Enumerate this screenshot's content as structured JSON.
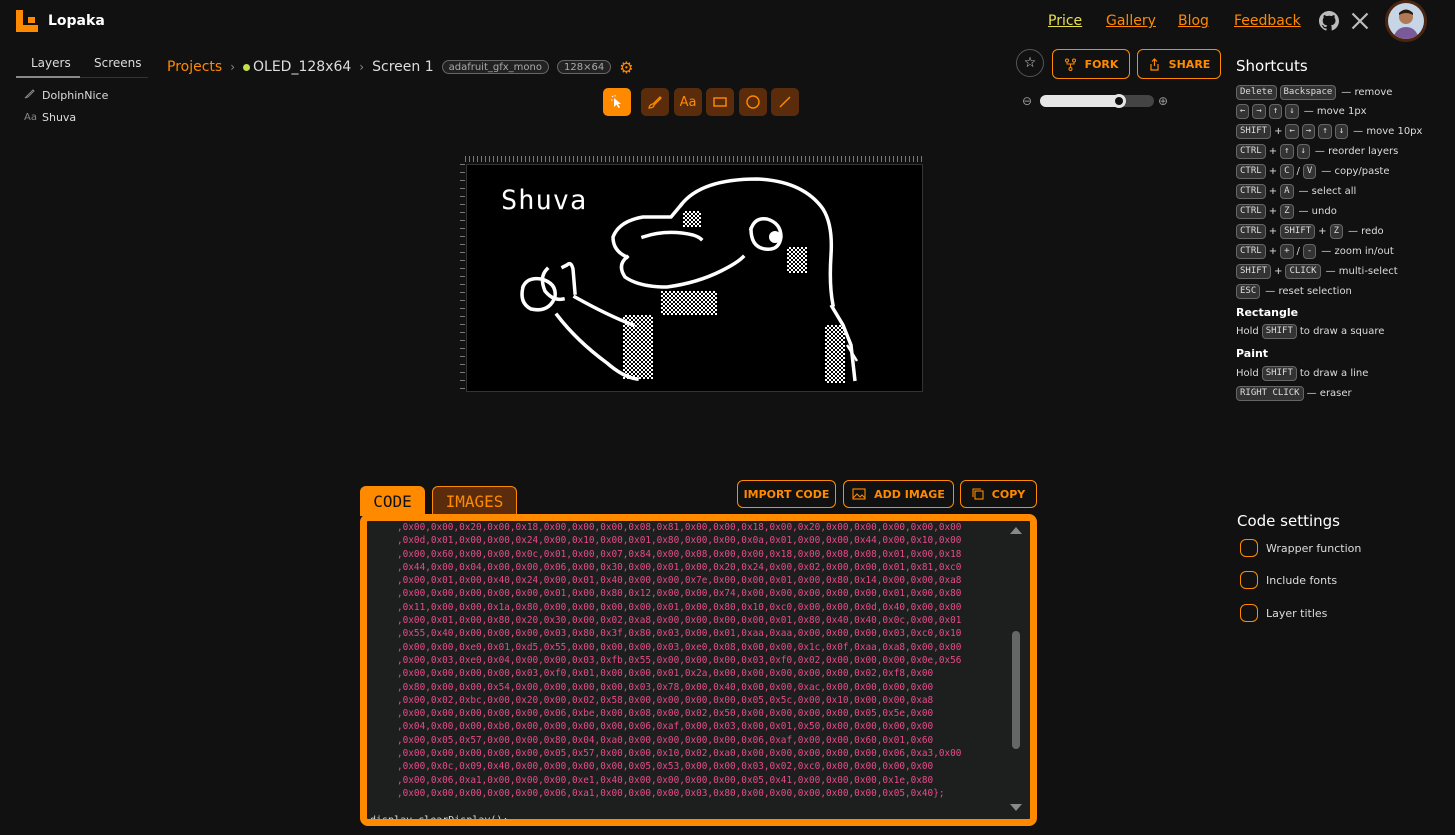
{
  "app": {
    "name": "Lopaka",
    "accent": "#ff8a00"
  },
  "nav": {
    "price": "Price",
    "gallery": "Gallery",
    "blog": "Blog",
    "feedback": "Feedback"
  },
  "left_panel": {
    "tabs": [
      "Layers",
      "Screens"
    ],
    "layers": [
      {
        "name": "DolphinNice",
        "icon": "paint-icon"
      },
      {
        "name": "Shuva",
        "icon": "text-icon",
        "icon_glyph": "Aa"
      }
    ]
  },
  "breadcrumb": {
    "projects": "Projects",
    "project": "OLED_128x64",
    "screen": "Screen 1",
    "library": "adafruit_gfx_mono",
    "size": "128×64"
  },
  "toolbar": {
    "text_tool": "Aa"
  },
  "actions": {
    "fork": "FORK",
    "share": "SHARE",
    "import_code": "IMPORT CODE",
    "add_image": "ADD IMAGE",
    "copy": "COPY"
  },
  "zoom": {
    "level": 0.72
  },
  "canvas": {
    "text_layer": "Shuva"
  },
  "code": {
    "tabs": [
      "CODE",
      "IMAGES"
    ],
    "lines": [
      ",0x00,0x00,0x20,0x00,0x18,0x00,0x00,0x00,0x08,0x81,0x00,0x00,0x18,0x00,0x20,0x00,0x00,0x00,0x00,0x00",
      ",0x0d,0x01,0x00,0x00,0x24,0x00,0x10,0x00,0x01,0x80,0x00,0x00,0x0a,0x01,0x00,0x00,0x44,0x00,0x10,0x00",
      ",0x00,0x60,0x00,0x00,0x0c,0x01,0x00,0x07,0x84,0x00,0x08,0x00,0x00,0x18,0x00,0x08,0x08,0x01,0x00,0x18",
      ",0x44,0x00,0x04,0x00,0x00,0x06,0x00,0x30,0x00,0x01,0x00,0x20,0x24,0x00,0x02,0x00,0x00,0x01,0x81,0xc0",
      ",0x00,0x01,0x00,0x40,0x24,0x00,0x01,0x40,0x00,0x00,0x7e,0x00,0x00,0x01,0x00,0x80,0x14,0x00,0x00,0xa8",
      ",0x00,0x00,0x00,0x00,0x00,0x01,0x00,0x80,0x12,0x00,0x00,0x74,0x00,0x00,0x00,0x00,0x00,0x01,0x00,0x80",
      ",0x11,0x00,0x00,0x1a,0x80,0x00,0x00,0x00,0x00,0x01,0x00,0x80,0x10,0xc0,0x00,0x00,0x0d,0x40,0x00,0x00",
      ",0x00,0x01,0x00,0x80,0x20,0x30,0x00,0x02,0xa8,0x00,0x00,0x00,0x00,0x01,0x80,0x40,0x40,0x0c,0x00,0x01",
      ",0x55,0x40,0x00,0x00,0x00,0x03,0x80,0x3f,0x80,0x03,0x00,0x01,0xaa,0xaa,0x00,0x00,0x00,0x03,0xc0,0x10",
      ",0x00,0x00,0xe0,0x01,0xd5,0x55,0x00,0x00,0x00,0x03,0xe0,0x08,0x00,0x00,0x1c,0x0f,0xaa,0xa8,0x00,0x00",
      ",0x00,0x03,0xe0,0x04,0x00,0x00,0x03,0xfb,0x55,0x00,0x00,0x00,0x03,0xf0,0x02,0x00,0x00,0x00,0x0e,0x56",
      ",0x00,0x00,0x00,0x00,0x03,0xf0,0x01,0x00,0x00,0x01,0x2a,0x00,0x00,0x00,0x00,0x00,0x02,0xf8,0x00",
      ",0x80,0x00,0x00,0x54,0x00,0x00,0x00,0x00,0x03,0x78,0x00,0x40,0x00,0x00,0xac,0x00,0x00,0x00,0x00",
      ",0x00,0x02,0xbc,0x00,0x20,0x00,0x02,0x58,0x00,0x00,0x00,0x00,0x05,0x5c,0x00,0x10,0x00,0x00,0xa8",
      ",0x00,0x00,0x00,0x00,0x00,0x06,0xbe,0x00,0x08,0x00,0x02,0x50,0x00,0x00,0x00,0x00,0x05,0x5e,0x00",
      ",0x04,0x00,0x00,0xb0,0x00,0x00,0x00,0x00,0x06,0xaf,0x00,0x03,0x00,0x01,0x50,0x00,0x00,0x00,0x00",
      ",0x00,0x05,0x57,0x00,0x00,0x80,0x04,0xa0,0x00,0x00,0x00,0x00,0x06,0xaf,0x00,0x00,0x60,0x01,0x60",
      ",0x00,0x00,0x00,0x00,0x00,0x05,0x57,0x00,0x00,0x10,0x02,0xa0,0x00,0x00,0x00,0x00,0x00,0x06,0xa3,0x00",
      ",0x00,0x0c,0x09,0x40,0x00,0x00,0x00,0x00,0x05,0x53,0x00,0x00,0x03,0x02,0xc0,0x00,0x00,0x00,0x00",
      ",0x00,0x06,0xa1,0x00,0x00,0x00,0xe1,0x40,0x00,0x00,0x00,0x00,0x05,0x41,0x00,0x00,0x00,0x1e,0x80",
      ",0x00,0x00,0x00,0x00,0x00,0x06,0xa1,0x00,0x00,0x00,0x03,0x80,0x00,0x00,0x00,0x00,0x00,0x05,0x40};"
    ],
    "footer_line": "display.clearDisplay();"
  },
  "shortcuts": {
    "title": "Shortcuts",
    "rows": [
      {
        "keys": [
          "Delete",
          "Backspace"
        ],
        "sep": "",
        "desc": "— remove"
      },
      {
        "keys": [
          "←",
          "→",
          "↑",
          "↓"
        ],
        "sep": "",
        "desc": "— move 1px"
      },
      {
        "keys": [
          "SHIFT",
          "+",
          "←",
          "→",
          "↑",
          "↓"
        ],
        "sep": "",
        "desc": "— move 10px"
      },
      {
        "keys": [
          "CTRL",
          "+",
          "↑",
          "↓"
        ],
        "sep": "",
        "desc": "— reorder layers"
      },
      {
        "keys": [
          "CTRL",
          "+",
          "C",
          "/",
          "V"
        ],
        "sep": "",
        "desc": "— copy/paste"
      },
      {
        "keys": [
          "CTRL",
          "+",
          "A"
        ],
        "sep": "",
        "desc": "— select all"
      },
      {
        "keys": [
          "CTRL",
          "+",
          "Z"
        ],
        "sep": "",
        "desc": "— undo"
      },
      {
        "keys": [
          "CTRL",
          "+",
          "SHIFT",
          "+",
          "Z"
        ],
        "sep": "",
        "desc": "— redo"
      },
      {
        "keys": [
          "CTRL",
          "+",
          "+",
          "/",
          "-"
        ],
        "sep": "",
        "desc": "— zoom in/out"
      },
      {
        "keys": [
          "SHIFT",
          "+",
          "CLICK"
        ],
        "sep": "",
        "desc": "— multi-select"
      },
      {
        "keys": [
          "ESC"
        ],
        "sep": "",
        "desc": "— reset selection"
      }
    ],
    "rectangle_head": "Rectangle",
    "rectangle": {
      "pre": "Hold",
      "key": "SHIFT",
      "post": "to draw a square"
    },
    "paint_head": "Paint",
    "paint": {
      "pre": "Hold",
      "key": "SHIFT",
      "post": "to draw a line"
    },
    "right_click": {
      "key": "RIGHT CLICK",
      "post": "— eraser"
    }
  },
  "code_settings": {
    "title": "Code settings",
    "options": [
      "Wrapper function",
      "Include fonts",
      "Layer titles"
    ]
  }
}
